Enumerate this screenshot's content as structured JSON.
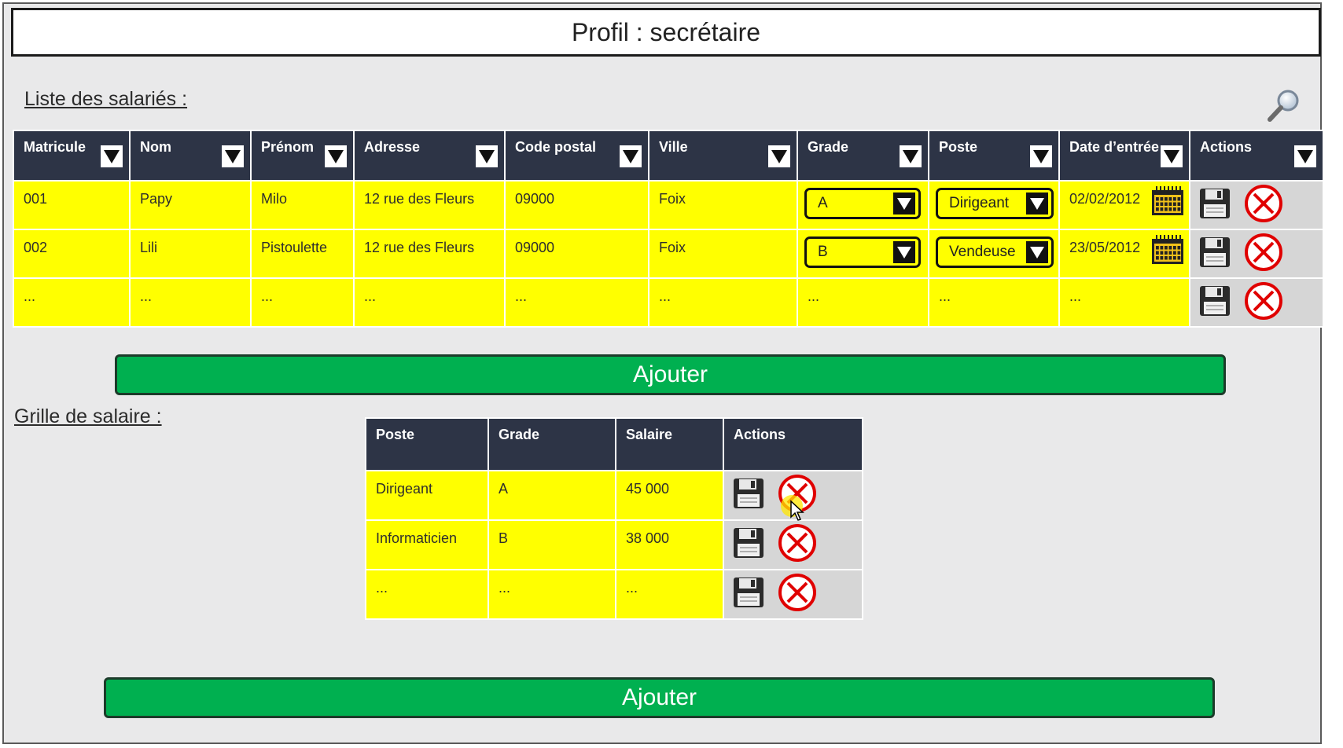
{
  "header": {
    "title": "Profil : secrétaire"
  },
  "employees": {
    "section_label": "Liste des salariés :",
    "columns": [
      "Matricule",
      "Nom",
      "Prénom",
      "Adresse",
      "Code postal",
      "Ville",
      "Grade",
      "Poste",
      "Date d’entrée",
      "Actions"
    ],
    "rows": [
      {
        "matricule": "001",
        "nom": "Papy",
        "prenom": "Milo",
        "adresse": "12 rue des Fleurs",
        "code_postal": "09000",
        "ville": "Foix",
        "grade": "A",
        "poste": "Dirigeant",
        "date": "02/02/2012"
      },
      {
        "matricule": "002",
        "nom": "Lili",
        "prenom": "Pistoulette",
        "adresse": "12 rue des Fleurs",
        "code_postal": "09000",
        "ville": "Foix",
        "grade": "B",
        "poste": "Vendeuse",
        "date": "23/05/2012"
      },
      {
        "matricule": "...",
        "nom": "...",
        "prenom": "...",
        "adresse": "...",
        "code_postal": "...",
        "ville": "...",
        "grade": "...",
        "poste": "...",
        "date": "..."
      }
    ],
    "add_label": "Ajouter"
  },
  "salary_grid": {
    "section_label": "Grille de salaire :",
    "columns": [
      "Poste",
      "Grade",
      "Salaire",
      "Actions"
    ],
    "rows": [
      {
        "poste": "Dirigeant",
        "grade": "A",
        "salaire": "45 000"
      },
      {
        "poste": "Informaticien",
        "grade": "B",
        "salaire": "38 000"
      },
      {
        "poste": "...",
        "grade": "...",
        "salaire": "..."
      }
    ],
    "add_label": "Ajouter"
  },
  "colors": {
    "header_bg": "#2d3446",
    "cell_bg": "#ffff00",
    "action_bg": "#d6d6d6",
    "add_button": "#00b050",
    "delete_red": "#e00000"
  },
  "icons": {
    "search": "magnifier-icon",
    "filter": "filter-dropdown-icon",
    "calendar": "calendar-icon",
    "save": "floppy-disk-icon",
    "delete": "delete-circle-x-icon"
  }
}
